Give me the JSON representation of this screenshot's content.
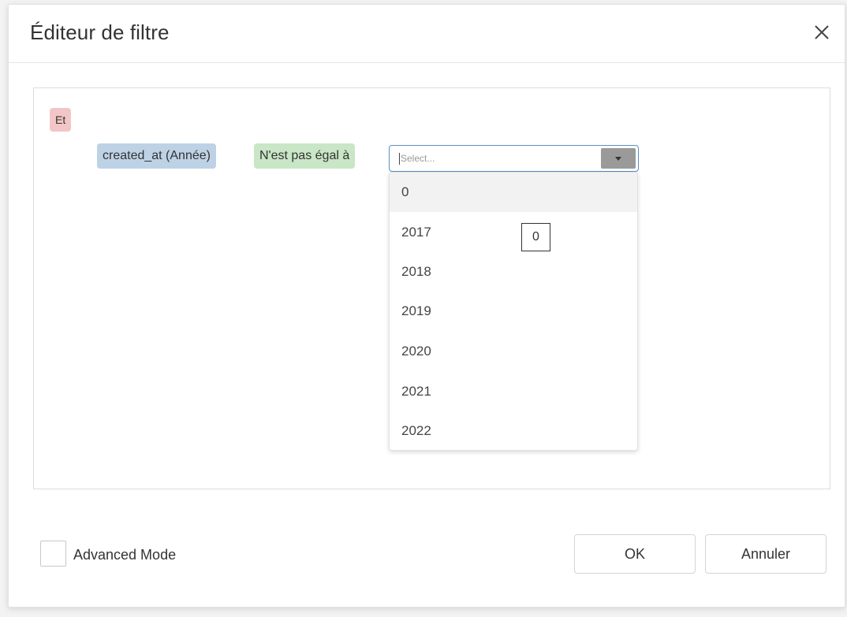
{
  "dialog": {
    "title": "Éditeur de filtre",
    "close_icon": "close-icon"
  },
  "filter": {
    "group_label": "Et",
    "group_color": "#f2c6c6",
    "condition": {
      "field": "created_at (Année)",
      "field_color": "#bed2e6",
      "operator": "N'est pas égal à",
      "operator_color": "#c9e6c6",
      "value_placeholder": "Select..."
    }
  },
  "dropdown": {
    "options": [
      "0",
      "2017",
      "2018",
      "2019",
      "2020",
      "2021",
      "2022"
    ],
    "highlighted_index": 0
  },
  "tooltip": {
    "text": "0"
  },
  "footer": {
    "advanced_mode_label": "Advanced Mode",
    "advanced_mode_checked": false,
    "ok_label": "OK",
    "cancel_label": "Annuler"
  }
}
